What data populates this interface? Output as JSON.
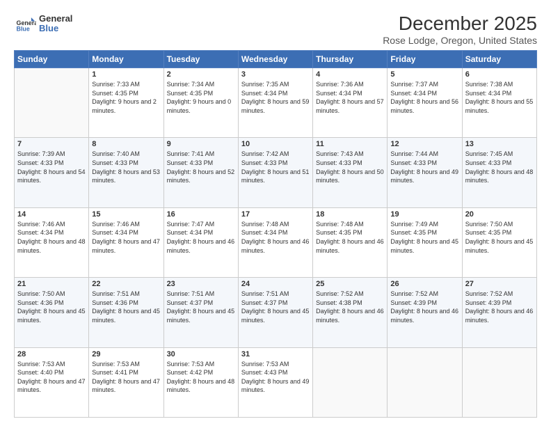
{
  "header": {
    "logo_line1": "General",
    "logo_line2": "Blue",
    "title": "December 2025",
    "subtitle": "Rose Lodge, Oregon, United States"
  },
  "days_of_week": [
    "Sunday",
    "Monday",
    "Tuesday",
    "Wednesday",
    "Thursday",
    "Friday",
    "Saturday"
  ],
  "weeks": [
    [
      {
        "day": "",
        "sunrise": "",
        "sunset": "",
        "daylight": "",
        "empty": true
      },
      {
        "day": "1",
        "sunrise": "Sunrise: 7:33 AM",
        "sunset": "Sunset: 4:35 PM",
        "daylight": "Daylight: 9 hours and 2 minutes."
      },
      {
        "day": "2",
        "sunrise": "Sunrise: 7:34 AM",
        "sunset": "Sunset: 4:35 PM",
        "daylight": "Daylight: 9 hours and 0 minutes."
      },
      {
        "day": "3",
        "sunrise": "Sunrise: 7:35 AM",
        "sunset": "Sunset: 4:34 PM",
        "daylight": "Daylight: 8 hours and 59 minutes."
      },
      {
        "day": "4",
        "sunrise": "Sunrise: 7:36 AM",
        "sunset": "Sunset: 4:34 PM",
        "daylight": "Daylight: 8 hours and 57 minutes."
      },
      {
        "day": "5",
        "sunrise": "Sunrise: 7:37 AM",
        "sunset": "Sunset: 4:34 PM",
        "daylight": "Daylight: 8 hours and 56 minutes."
      },
      {
        "day": "6",
        "sunrise": "Sunrise: 7:38 AM",
        "sunset": "Sunset: 4:34 PM",
        "daylight": "Daylight: 8 hours and 55 minutes."
      }
    ],
    [
      {
        "day": "7",
        "sunrise": "Sunrise: 7:39 AM",
        "sunset": "Sunset: 4:33 PM",
        "daylight": "Daylight: 8 hours and 54 minutes."
      },
      {
        "day": "8",
        "sunrise": "Sunrise: 7:40 AM",
        "sunset": "Sunset: 4:33 PM",
        "daylight": "Daylight: 8 hours and 53 minutes."
      },
      {
        "day": "9",
        "sunrise": "Sunrise: 7:41 AM",
        "sunset": "Sunset: 4:33 PM",
        "daylight": "Daylight: 8 hours and 52 minutes."
      },
      {
        "day": "10",
        "sunrise": "Sunrise: 7:42 AM",
        "sunset": "Sunset: 4:33 PM",
        "daylight": "Daylight: 8 hours and 51 minutes."
      },
      {
        "day": "11",
        "sunrise": "Sunrise: 7:43 AM",
        "sunset": "Sunset: 4:33 PM",
        "daylight": "Daylight: 8 hours and 50 minutes."
      },
      {
        "day": "12",
        "sunrise": "Sunrise: 7:44 AM",
        "sunset": "Sunset: 4:33 PM",
        "daylight": "Daylight: 8 hours and 49 minutes."
      },
      {
        "day": "13",
        "sunrise": "Sunrise: 7:45 AM",
        "sunset": "Sunset: 4:33 PM",
        "daylight": "Daylight: 8 hours and 48 minutes."
      }
    ],
    [
      {
        "day": "14",
        "sunrise": "Sunrise: 7:46 AM",
        "sunset": "Sunset: 4:34 PM",
        "daylight": "Daylight: 8 hours and 48 minutes."
      },
      {
        "day": "15",
        "sunrise": "Sunrise: 7:46 AM",
        "sunset": "Sunset: 4:34 PM",
        "daylight": "Daylight: 8 hours and 47 minutes."
      },
      {
        "day": "16",
        "sunrise": "Sunrise: 7:47 AM",
        "sunset": "Sunset: 4:34 PM",
        "daylight": "Daylight: 8 hours and 46 minutes."
      },
      {
        "day": "17",
        "sunrise": "Sunrise: 7:48 AM",
        "sunset": "Sunset: 4:34 PM",
        "daylight": "Daylight: 8 hours and 46 minutes."
      },
      {
        "day": "18",
        "sunrise": "Sunrise: 7:48 AM",
        "sunset": "Sunset: 4:35 PM",
        "daylight": "Daylight: 8 hours and 46 minutes."
      },
      {
        "day": "19",
        "sunrise": "Sunrise: 7:49 AM",
        "sunset": "Sunset: 4:35 PM",
        "daylight": "Daylight: 8 hours and 45 minutes."
      },
      {
        "day": "20",
        "sunrise": "Sunrise: 7:50 AM",
        "sunset": "Sunset: 4:35 PM",
        "daylight": "Daylight: 8 hours and 45 minutes."
      }
    ],
    [
      {
        "day": "21",
        "sunrise": "Sunrise: 7:50 AM",
        "sunset": "Sunset: 4:36 PM",
        "daylight": "Daylight: 8 hours and 45 minutes."
      },
      {
        "day": "22",
        "sunrise": "Sunrise: 7:51 AM",
        "sunset": "Sunset: 4:36 PM",
        "daylight": "Daylight: 8 hours and 45 minutes."
      },
      {
        "day": "23",
        "sunrise": "Sunrise: 7:51 AM",
        "sunset": "Sunset: 4:37 PM",
        "daylight": "Daylight: 8 hours and 45 minutes."
      },
      {
        "day": "24",
        "sunrise": "Sunrise: 7:51 AM",
        "sunset": "Sunset: 4:37 PM",
        "daylight": "Daylight: 8 hours and 45 minutes."
      },
      {
        "day": "25",
        "sunrise": "Sunrise: 7:52 AM",
        "sunset": "Sunset: 4:38 PM",
        "daylight": "Daylight: 8 hours and 46 minutes."
      },
      {
        "day": "26",
        "sunrise": "Sunrise: 7:52 AM",
        "sunset": "Sunset: 4:39 PM",
        "daylight": "Daylight: 8 hours and 46 minutes."
      },
      {
        "day": "27",
        "sunrise": "Sunrise: 7:52 AM",
        "sunset": "Sunset: 4:39 PM",
        "daylight": "Daylight: 8 hours and 46 minutes."
      }
    ],
    [
      {
        "day": "28",
        "sunrise": "Sunrise: 7:53 AM",
        "sunset": "Sunset: 4:40 PM",
        "daylight": "Daylight: 8 hours and 47 minutes."
      },
      {
        "day": "29",
        "sunrise": "Sunrise: 7:53 AM",
        "sunset": "Sunset: 4:41 PM",
        "daylight": "Daylight: 8 hours and 47 minutes."
      },
      {
        "day": "30",
        "sunrise": "Sunrise: 7:53 AM",
        "sunset": "Sunset: 4:42 PM",
        "daylight": "Daylight: 8 hours and 48 minutes."
      },
      {
        "day": "31",
        "sunrise": "Sunrise: 7:53 AM",
        "sunset": "Sunset: 4:43 PM",
        "daylight": "Daylight: 8 hours and 49 minutes."
      },
      {
        "day": "",
        "sunrise": "",
        "sunset": "",
        "daylight": "",
        "empty": true
      },
      {
        "day": "",
        "sunrise": "",
        "sunset": "",
        "daylight": "",
        "empty": true
      },
      {
        "day": "",
        "sunrise": "",
        "sunset": "",
        "daylight": "",
        "empty": true
      }
    ]
  ]
}
